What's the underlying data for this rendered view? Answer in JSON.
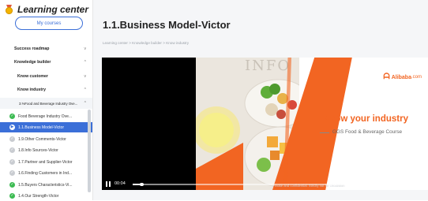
{
  "sidebar": {
    "logo_text": "Learning center",
    "my_courses": "My courses",
    "nav": [
      {
        "label": "Success roadmap",
        "chevron": "v"
      },
      {
        "label": "Knowledge builder",
        "chevron": "^"
      },
      {
        "label": "Know customer",
        "chevron": "v"
      },
      {
        "label": "Know industry",
        "chevron": "^"
      },
      {
        "label": "3.%Food and Beverage Industry Ove...",
        "chevron": "^"
      }
    ],
    "lessons": [
      {
        "label": "Food Beverage Industry Ove...",
        "status": "done"
      },
      {
        "label": "1.1.Business Model-Victor",
        "status": "playing",
        "active": true
      },
      {
        "label": "1.9.Other Comments-Victor",
        "status": "todo"
      },
      {
        "label": "1.8.Info Sources-Victor",
        "status": "todo"
      },
      {
        "label": "1.7.Partner and Supplier-Victor",
        "status": "todo"
      },
      {
        "label": "1.6.Finding Customers in Ind...",
        "status": "todo"
      },
      {
        "label": "1.5.Buyers Characteristics-Vi...",
        "status": "done"
      },
      {
        "label": "1.4.Our Strength-Victor",
        "status": "done"
      }
    ]
  },
  "main": {
    "title": "1.1.Business Model-Victor",
    "breadcrumb": "Learning center > Knowledge builder > Know industry",
    "video": {
      "headline": "Know your industry",
      "subheadline": "GGS Food & Beverage Course",
      "brand": "Alibaba",
      "brand_suffix": ".com",
      "time": "00:04",
      "progress": 0.03,
      "paused": true,
      "footnote": "Private and confidential. Strictly not for circulation"
    }
  },
  "colors": {
    "accent": "#3b6fd8",
    "brand_orange": "#f26522",
    "done_green": "#3dbb53"
  }
}
